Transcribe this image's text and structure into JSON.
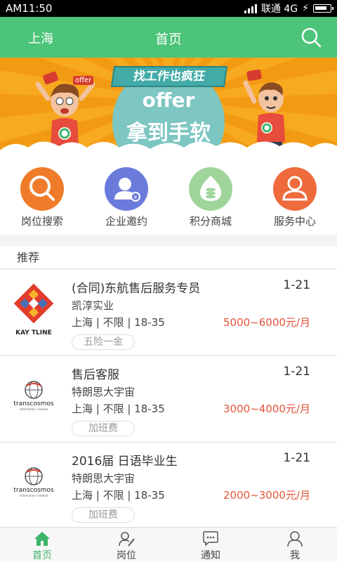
{
  "status_bar": {
    "time": "AM11:50",
    "carrier": "联通 4G"
  },
  "header": {
    "city": "上海",
    "title": "首页"
  },
  "banner": {
    "tag_text": "找工作也疯狂",
    "offer_text": "offer",
    "slogan": "拿到手软",
    "sticker": "offer"
  },
  "menu": [
    {
      "label": "岗位搜索",
      "color": "#f07b2a"
    },
    {
      "label": "企业邀约",
      "color": "#6b7bdc"
    },
    {
      "label": "积分商城",
      "color": "#9fd59b"
    },
    {
      "label": "服务中心",
      "color": "#ef6a3c"
    }
  ],
  "recommend_title": "推荐",
  "jobs": [
    {
      "title": "(合同)东航售后服务专员",
      "date": "1-21",
      "company": "凯淳实业",
      "meta": "上海 | 不限 | 18-35",
      "salary": "5000~6000元/月",
      "tag": "五险一金",
      "logo_text": "KAY TLINE"
    },
    {
      "title": "售后客服",
      "date": "1-21",
      "company": "特朗思大宇宙",
      "meta": "上海 | 不限 | 18-35",
      "salary": "3000~4000元/月",
      "tag": "加班费",
      "logo_text": "transcosmos",
      "logo_sub": "information creative"
    },
    {
      "title": "2016届 日语毕业生",
      "date": "1-21",
      "company": "特朗思大宇宙",
      "meta": "上海 | 不限 | 18-35",
      "salary": "2000~3000元/月",
      "tag": "加班费",
      "logo_text": "transcosmos",
      "logo_sub": "information creative"
    }
  ],
  "bottom_nav": [
    {
      "label": "首页",
      "active": true
    },
    {
      "label": "岗位",
      "active": false
    },
    {
      "label": "通知",
      "active": false
    },
    {
      "label": "我",
      "active": false
    }
  ]
}
